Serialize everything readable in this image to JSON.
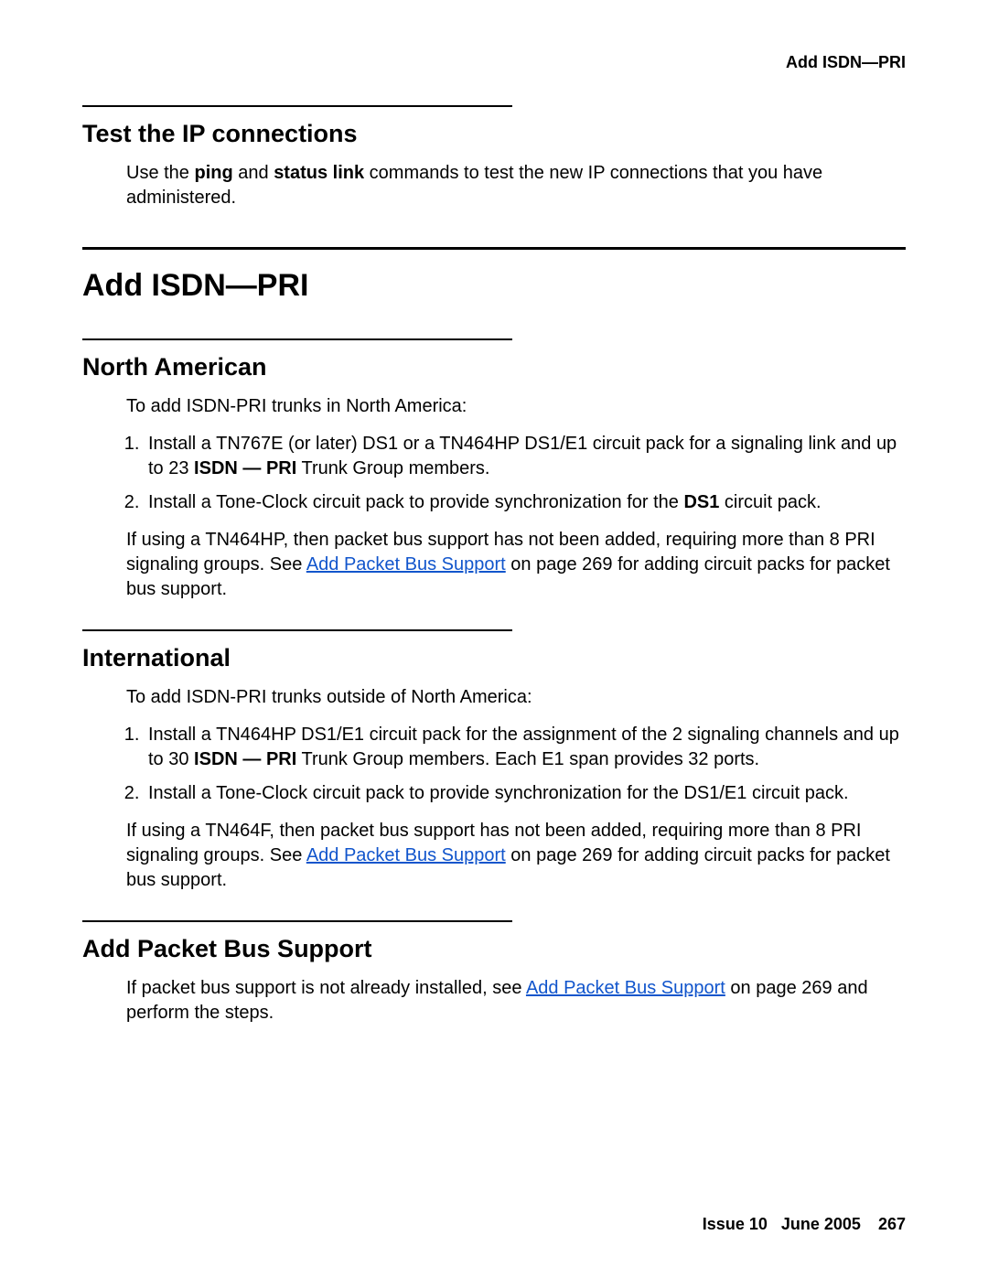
{
  "header": {
    "running_title": "Add ISDN—PRI"
  },
  "sections": {
    "test_ip": {
      "title": "Test the IP connections",
      "para_pre": "Use the ",
      "bold1": "ping",
      "mid1": " and ",
      "bold2": "status link",
      "para_post": " commands to test the new IP connections that you have administered."
    },
    "add_isdn": {
      "title": "Add ISDN—PRI"
    },
    "north_american": {
      "title": "North American",
      "intro": "To add ISDN-PRI trunks in North America:",
      "step1_pre": "Install a TN767E (or later) DS1 or a TN464HP DS1/E1 circuit pack for a signaling link and up to 23 ",
      "step1_bold": "ISDN — PRI",
      "step1_post": " Trunk Group members.",
      "step2_pre": "Install a Tone-Clock circuit pack to provide synchronization for the ",
      "step2_bold": "DS1",
      "step2_post": " circuit pack.",
      "note_pre": "If using a TN464HP, then packet bus support has not been added, requiring more than 8 PRI signaling groups. See ",
      "note_link": "Add Packet Bus Support",
      "note_post": " on page 269 for adding circuit packs for packet bus support."
    },
    "international": {
      "title": "International",
      "intro": "To add ISDN-PRI trunks outside of North America:",
      "step1_pre": "Install a TN464HP DS1/E1 circuit pack for the assignment of the 2 signaling channels and up to 30 ",
      "step1_bold": "ISDN — PRI",
      "step1_post": " Trunk Group members. Each E1 span provides 32 ports.",
      "step2": "Install a Tone-Clock circuit pack to provide synchronization for the DS1/E1 circuit pack.",
      "note_pre": "If using a TN464F, then packet bus support has not been added, requiring more than 8 PRI signaling groups. See ",
      "note_link": "Add Packet Bus Support",
      "note_post": " on page 269 for adding circuit packs for packet bus support."
    },
    "packet_bus": {
      "title": "Add Packet Bus Support",
      "para_pre": "If packet bus support is not already installed, see ",
      "para_link": "Add Packet Bus Support",
      "para_post": " on page 269 and perform the steps."
    }
  },
  "footer": {
    "issue": "Issue 10",
    "date": "June 2005",
    "page": "267"
  }
}
